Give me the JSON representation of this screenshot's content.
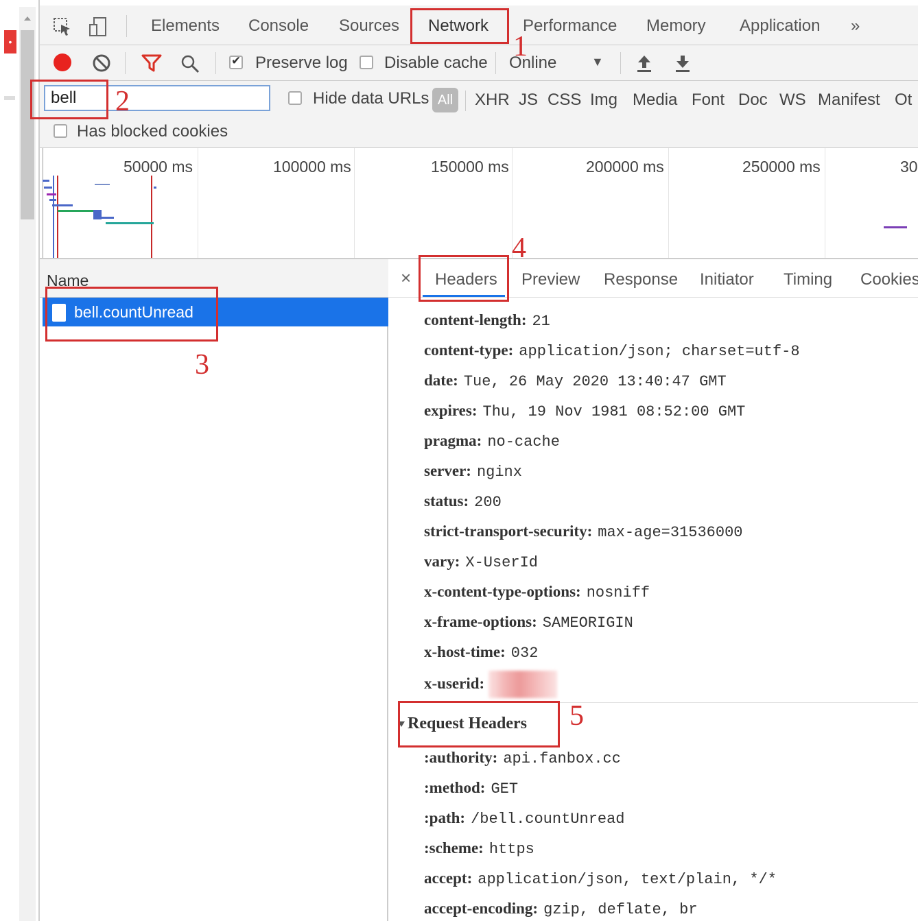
{
  "page_strip": {
    "tab_glyph": "•"
  },
  "tabs": {
    "items": [
      "Elements",
      "Console",
      "Sources",
      "Network",
      "Performance",
      "Memory",
      "Application"
    ],
    "more": "»",
    "active": "Network"
  },
  "toolbar": {
    "preserve_log": {
      "label": "Preserve log",
      "checked": true
    },
    "disable_cache": {
      "label": "Disable cache",
      "checked": false
    },
    "throttle": "Online",
    "throttle_arrow": "▼"
  },
  "filter": {
    "value": "bell",
    "hide_data_urls": {
      "label": "Hide data URLs",
      "checked": false
    },
    "all_label": "All",
    "types": [
      "XHR",
      "JS",
      "CSS",
      "Img",
      "Media",
      "Font",
      "Doc",
      "WS",
      "Manifest",
      "Ot"
    ],
    "has_blocked_cookies": {
      "label": "Has blocked cookies",
      "checked": false
    }
  },
  "timeline": {
    "ticks": [
      "50000 ms",
      "100000 ms",
      "150000 ms",
      "200000 ms",
      "250000 ms",
      "30"
    ]
  },
  "requests": {
    "header": "Name",
    "rows": [
      "bell.countUnread"
    ]
  },
  "detail": {
    "close": "×",
    "tabs": [
      "Headers",
      "Preview",
      "Response",
      "Initiator",
      "Timing",
      "Cookies"
    ],
    "active_tab": "Headers",
    "response_headers": [
      {
        "k": "content-length:",
        "v": "21"
      },
      {
        "k": "content-type:",
        "v": "application/json; charset=utf-8"
      },
      {
        "k": "date:",
        "v": "Tue, 26 May 2020 13:40:47 GMT"
      },
      {
        "k": "expires:",
        "v": "Thu, 19 Nov 1981 08:52:00 GMT"
      },
      {
        "k": "pragma:",
        "v": "no-cache"
      },
      {
        "k": "server:",
        "v": "nginx"
      },
      {
        "k": "status:",
        "v": "200"
      },
      {
        "k": "strict-transport-security:",
        "v": "max-age=31536000"
      },
      {
        "k": "vary:",
        "v": "X-UserId"
      },
      {
        "k": "x-content-type-options:",
        "v": "nosniff"
      },
      {
        "k": "x-frame-options:",
        "v": "SAMEORIGIN"
      },
      {
        "k": "x-host-time:",
        "v": "032"
      },
      {
        "k": "x-userid:",
        "v": ""
      }
    ],
    "request_headers_title": "Request Headers",
    "request_headers": [
      {
        "k": ":authority:",
        "v": "api.fanbox.cc"
      },
      {
        "k": ":method:",
        "v": "GET"
      },
      {
        "k": ":path:",
        "v": "/bell.countUnread"
      },
      {
        "k": ":scheme:",
        "v": "https"
      },
      {
        "k": "accept:",
        "v": "application/json, text/plain, */*"
      },
      {
        "k": "accept-encoding:",
        "v": "gzip, deflate, br"
      }
    ]
  },
  "annotations": [
    "1",
    "2",
    "3",
    "4",
    "5"
  ],
  "colors": {
    "accent": "#1a73e8",
    "annotation": "#d32f2f",
    "record": "#e8231f"
  }
}
